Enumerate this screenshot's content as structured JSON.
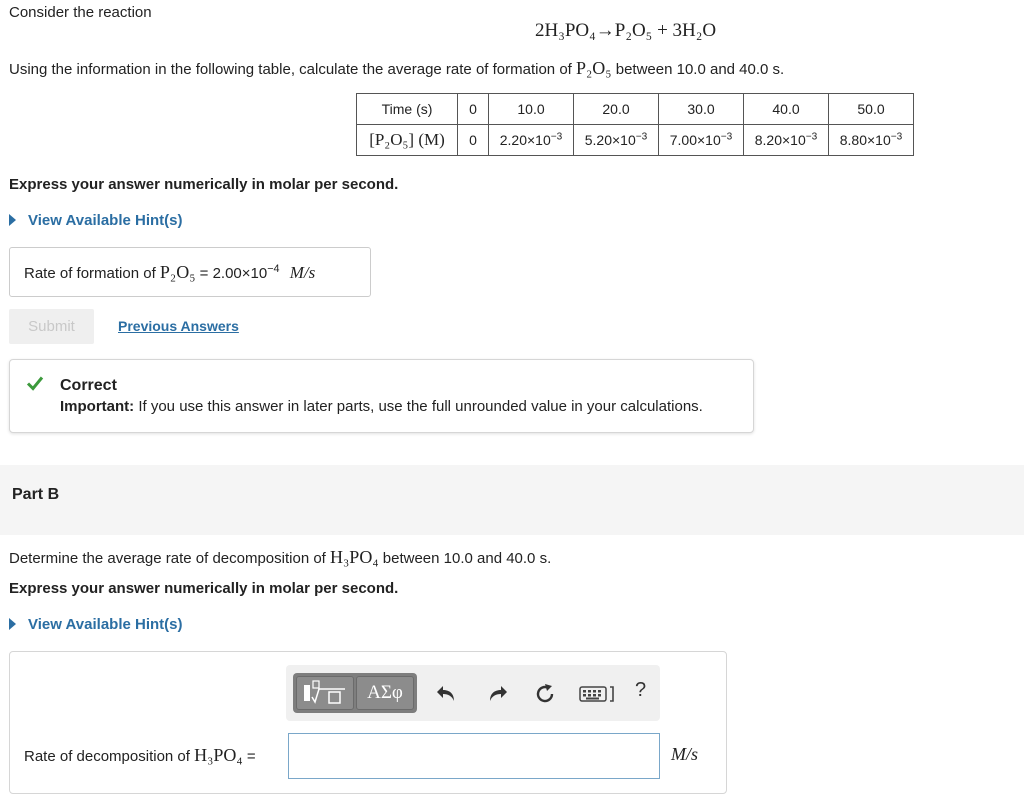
{
  "partA": {
    "intro": "Consider the reaction",
    "equation": {
      "reactant": "2H₃PO₄",
      "arrow": "→",
      "product1": "P₂O₅",
      "plus": "+",
      "product2": "3H₂O"
    },
    "instruction_pre": "Using the information in the following table, calculate the average rate of formation of",
    "instruction_species": "P₂O₅",
    "instruction_post": "between 10.0 and 40.0 s.",
    "table": {
      "time_header": "Time (s)",
      "conc_header": "[P₂O₅] (M)",
      "times": [
        "0",
        "10.0",
        "20.0",
        "30.0",
        "40.0",
        "50.0"
      ],
      "concentrations": [
        {
          "mantissa": "0",
          "exp": ""
        },
        {
          "mantissa": "2.20×10",
          "exp": "−3"
        },
        {
          "mantissa": "5.20×10",
          "exp": "−3"
        },
        {
          "mantissa": "7.00×10",
          "exp": "−3"
        },
        {
          "mantissa": "8.20×10",
          "exp": "−3"
        },
        {
          "mantissa": "8.80×10",
          "exp": "−3"
        }
      ]
    },
    "express": "Express your answer numerically in molar per second.",
    "hint_link": "View Available Hint(s)",
    "answer_label_pre": "Rate of formation of",
    "answer_label_species": "P₂O₅",
    "equals": "=",
    "answer_mantissa": "2.00×10",
    "answer_exp": "−4",
    "answer_unit": "M/s",
    "submit_label": "Submit",
    "previous_answers_label": "Previous Answers",
    "feedback_title": "Correct",
    "feedback_important": "Important:",
    "feedback_text": " If you use this answer in later parts, use the full unrounded value in your calculations."
  },
  "partB": {
    "label": "Part B",
    "question_pre": "Determine the average rate of decomposition of",
    "question_species": "H₃PO₄",
    "question_post": "between 10.0 and 40.0 s.",
    "express": "Express your answer numerically in molar per second.",
    "hint_link": "View Available Hint(s)",
    "toolbar_symbols_label": "ΑΣφ",
    "help_label": "?",
    "answer_label_pre": "Rate of decomposition of",
    "answer_label_species": "H₃PO₄",
    "equals": "=",
    "input_value": "",
    "unit": "M/s"
  },
  "colors": {
    "link": "#2b6ea3",
    "correct_green": "#3c9a3c",
    "submit_disabled_bg": "#efefef"
  },
  "icons": [
    "checkmark-icon",
    "play-triangle-icon",
    "templates-icon",
    "undo-icon",
    "redo-icon",
    "reset-icon",
    "keyboard-icon",
    "help-icon"
  ]
}
